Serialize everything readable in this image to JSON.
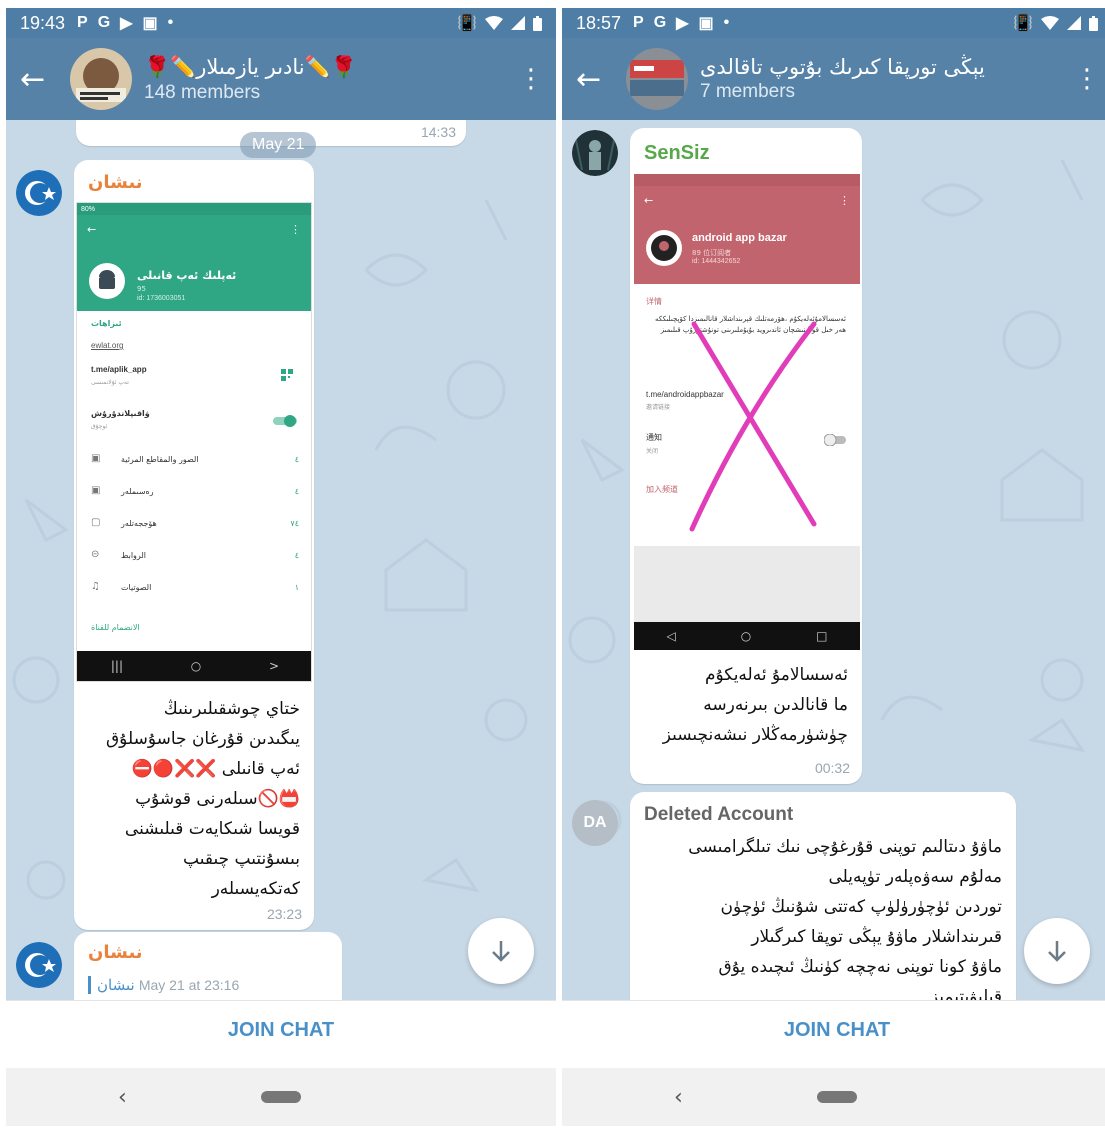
{
  "left": {
    "status": {
      "time": "19:43",
      "icons": [
        "P",
        "G",
        "▶",
        "▣",
        "•"
      ]
    },
    "group_title": "🌹✏️نادىر يازمىلار✏️🌹",
    "members": "148 members",
    "date_pill": "May 21",
    "prev_time": "14:33",
    "msg1": {
      "sender": "نىشان",
      "shot": {
        "status": "80%",
        "channel": "ئەپلىك ئەپ قانىلى",
        "members": "95",
        "id": "id: 1736003051",
        "section": "ئىزاھات",
        "link1": "ewlat.org",
        "link2": "t.me/aplik_app",
        "link2_sub": "تەپ ئۇلانمىسى",
        "notify": "ۋاقىپلاندۇرۇش",
        "notify_sub": "ئوچۇق",
        "rows": [
          "الصور والمقاطع المرئية",
          "رەسىملەر",
          "ھۆججەتلەر",
          "الروابط",
          "الصوتيات"
        ],
        "rows_n": [
          "٤",
          "٤",
          "٧٤",
          "٤",
          "١"
        ],
        "join": "الانضمام للقناة"
      },
      "text": "ختاي چوشقىلىرىنىڭ\nيىگىدىن قۇرغان جاسۇسلۇق\nئەپ قانىلى ❌❌🔴⛔\n📛🚫سىلەرنى قوشۇپ\nقويسا شىكايەت قىلىشنى\nبىسۇنتىپ چىقىپ\nكەتكەيسىلەر",
      "time": "23:23"
    },
    "msg2": {
      "sender": "نىشان",
      "quote_name": "نىشان",
      "quote_time": "May 21 at 23:16"
    },
    "join": "JOIN CHAT"
  },
  "right": {
    "status": {
      "time": "18:57",
      "icons": [
        "P",
        "G",
        "▶",
        "▣",
        "•"
      ]
    },
    "group_title": "يېڭى تورپقا كىرىك بۇتوپ تاقالدى",
    "members": "7 members",
    "msg1": {
      "sender": "SenSiz",
      "shot": {
        "channel": "android app bazar",
        "sub1": "89 位订阅者",
        "sub2": "id: 1444342652",
        "detail": "详情",
        "desc": "ئەسسالامۇئەلەيكۇم ،ھۆرمەتلىك قېرىنداشلار قانالىمىزدا كۆپچىلىككە ھەر خىل قوللىنىشچان ئاندىرويد بۇيۇملىرىنى تونۇشتۇرۇپ قىلىمىز",
        "link": "t.me/androidappbazar",
        "link_sub": "邀请链接",
        "notify": "通知",
        "notify_sub": "关闭",
        "join": "加入频道"
      },
      "text": "ئەسسالامۇ ئەلەيكۇم\nما قانالدىن بىرنەرسە\nچۈشۈرمەڭلار نىشەنچىسىز",
      "time": "00:32"
    },
    "msg2": {
      "avatar": "DA",
      "sender": "Deleted Account",
      "text": "ماۋۇ دىتالىم توپنى قۇرغۇچى نىك تىلگرامىسى\nمەلۇم سەۋەپلەر تۈپەيلى\nتوردىن ئۈچۈرۈلۈپ كەتتى شۇنىڭ ئۈچۈن\nقىرىنداشلار ماۋۇ يېڭى توپقا كىرگىلار\nماۋۇ كونا توپنى نەچچە كۈنىڭ ئىچىدە يۇق\nقىلىۋىتىمىز"
    },
    "join": "JOIN CHAT"
  }
}
